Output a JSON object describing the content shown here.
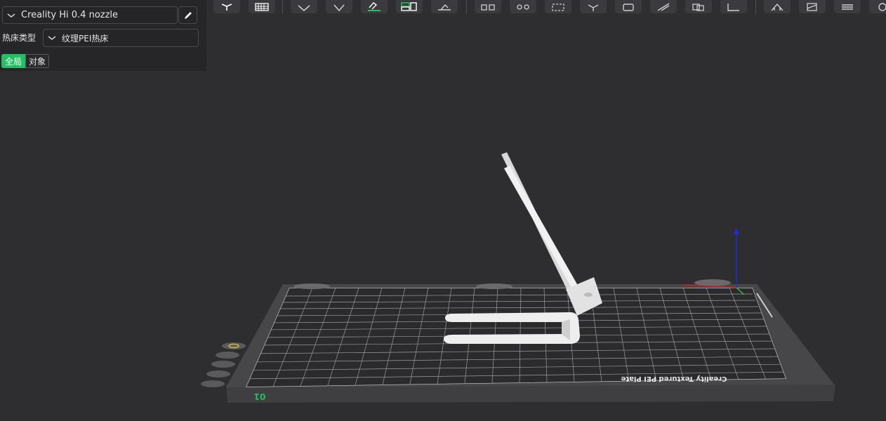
{
  "panel": {
    "printer": "Creality Hi 0.4 nozzle",
    "bed_type_label": "热床类型",
    "bed_type_value": "纹理PEI热床",
    "scope_tabs": [
      "全局",
      "对象"
    ]
  },
  "toolbar": {
    "tools": [
      {
        "name": "add-cube-icon"
      },
      {
        "name": "plate-grid-icon"
      },
      {
        "name": "arrange-icon"
      },
      {
        "name": "orient-icon"
      },
      {
        "name": "paint-support-icon"
      },
      {
        "name": "layout-icon"
      },
      {
        "name": "lay-on-face-icon"
      },
      {
        "name": "split-objects-icon"
      },
      {
        "name": "split-parts-icon"
      },
      {
        "name": "scale-icon"
      },
      {
        "name": "cube-rotate-icon"
      },
      {
        "name": "hollow-icon"
      },
      {
        "name": "cut-icon"
      },
      {
        "name": "boolean-icon"
      },
      {
        "name": "measure-icon"
      },
      {
        "name": "support-paint-icon"
      },
      {
        "name": "seam-icon"
      },
      {
        "name": "layers-icon"
      },
      {
        "name": "color-paint-icon"
      }
    ]
  },
  "viewport": {
    "plate_number": "01",
    "plate_brand_text": "Creality Textured PEI Plate",
    "colors": {
      "accent": "#21c063",
      "axis_x": "#d11c1c",
      "axis_y": "#22c22e",
      "axis_z": "#1b2fd8",
      "background": "#2e2e31"
    }
  }
}
